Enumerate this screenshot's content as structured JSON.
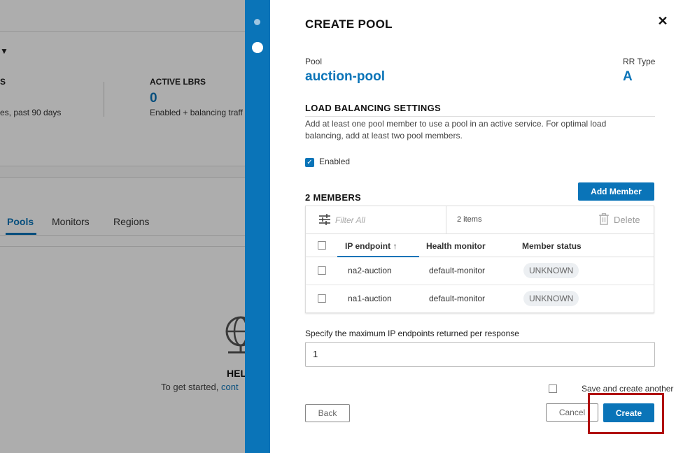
{
  "background": {
    "stat_partial_label": "S",
    "stat_partial_sub": "es, past 90 days",
    "active_lbrs_label": "ACTIVE LBRS",
    "active_lbrs_value": "0",
    "active_lbrs_sub": "Enabled + balancing traff",
    "tabs": [
      "Pools",
      "Monitors",
      "Regions"
    ],
    "empty_title": "HEL",
    "empty_text": "To get started, ",
    "empty_link": "cont"
  },
  "panel": {
    "title": "CREATE POOL",
    "pool_label": "Pool",
    "pool_value": "auction-pool",
    "rr_label": "RR Type",
    "rr_value": "A",
    "lb_title": "LOAD BALANCING SETTINGS",
    "lb_desc": "Add at least one pool member to use a pool in an active service. For optimal load balancing, add at least two pool members.",
    "enabled_label": "Enabled",
    "members_title": "2 MEMBERS",
    "add_member_label": "Add Member",
    "filter_placeholder": "Filter All",
    "items_count": "2 items",
    "delete_label": "Delete",
    "columns": [
      "IP endpoint",
      "Health monitor",
      "Member status"
    ],
    "sort_arrow": "↑",
    "rows": [
      {
        "endpoint": "na2-auction",
        "monitor": "default-monitor",
        "status": "UNKNOWN"
      },
      {
        "endpoint": "na1-auction",
        "monitor": "default-monitor",
        "status": "UNKNOWN"
      }
    ],
    "max_label": "Specify the maximum IP endpoints returned per response",
    "max_value": "1",
    "save_another_label": "Save and create another",
    "back_label": "Back",
    "cancel_label": "Cancel",
    "create_label": "Create"
  },
  "colors": {
    "accent": "#0a74b8",
    "highlight": "#b00f0f",
    "badge_bg": "#eceff2"
  }
}
